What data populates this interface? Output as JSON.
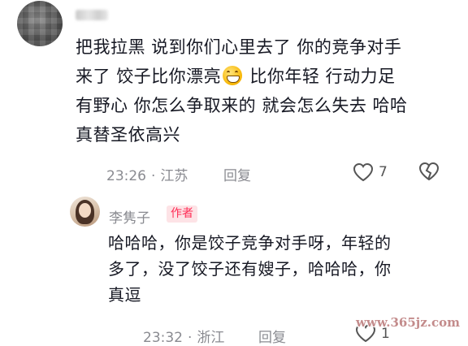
{
  "comment": {
    "lines": [
      "把我拉黑 说到你们心里去了 你的竞争对手",
      "来了 饺子比你漂亮",
      " 比你年轻 行动力足",
      "有野心 你怎么争取来的 就会怎么失去 哈哈",
      "真替圣依高兴"
    ],
    "emoji_icon": "grinning-face-icon",
    "time": "23:26",
    "separator": "·",
    "location": "江苏",
    "reply_label": "回复",
    "like_count": "7"
  },
  "reply": {
    "author": "李隽子",
    "badge": "作者",
    "lines": [
      "哈哈哈，你是饺子竞争对手呀，年轻的",
      "多了，没了饺子还有嫂子，哈哈哈，你",
      "真逗"
    ],
    "time": "23:32",
    "separator": "·",
    "location": "浙江",
    "reply_label": "回复",
    "like_count": "1"
  },
  "watermark": "www.365jz.com",
  "colors": {
    "text": "#161823",
    "meta": "#8a8b91",
    "badge_bg": "#fde3e6",
    "badge_text": "#fe2c55"
  }
}
